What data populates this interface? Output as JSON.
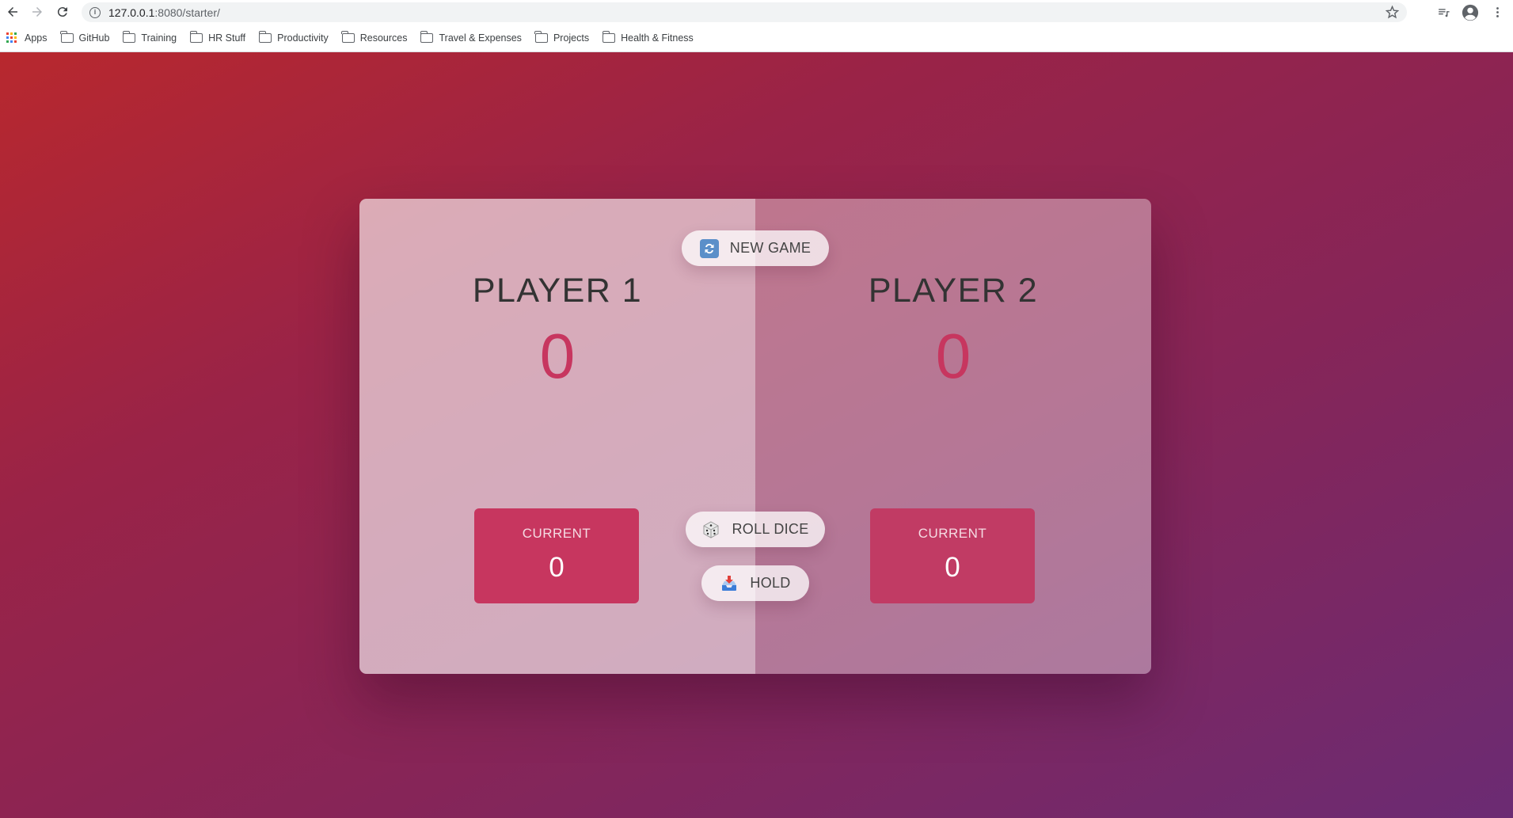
{
  "browser": {
    "url_host": "127.0.0.1",
    "url_rest": ":8080/starter/",
    "bookmarks": [
      "Apps",
      "GitHub",
      "Training",
      "HR Stuff",
      "Productivity",
      "Resources",
      "Travel & Expenses",
      "Projects",
      "Health & Fitness"
    ]
  },
  "game": {
    "new_game_label": "NEW GAME",
    "roll_dice_label": "ROLL DICE",
    "hold_label": "HOLD",
    "players": [
      {
        "name": "PLAYER 1",
        "score": "0",
        "current_label": "CURRENT",
        "current_score": "0"
      },
      {
        "name": "PLAYER 2",
        "score": "0",
        "current_label": "CURRENT",
        "current_score": "0"
      }
    ]
  },
  "colors": {
    "accent": "#c7365f",
    "bg_start": "#b8282e",
    "bg_end": "#6b2b73"
  }
}
